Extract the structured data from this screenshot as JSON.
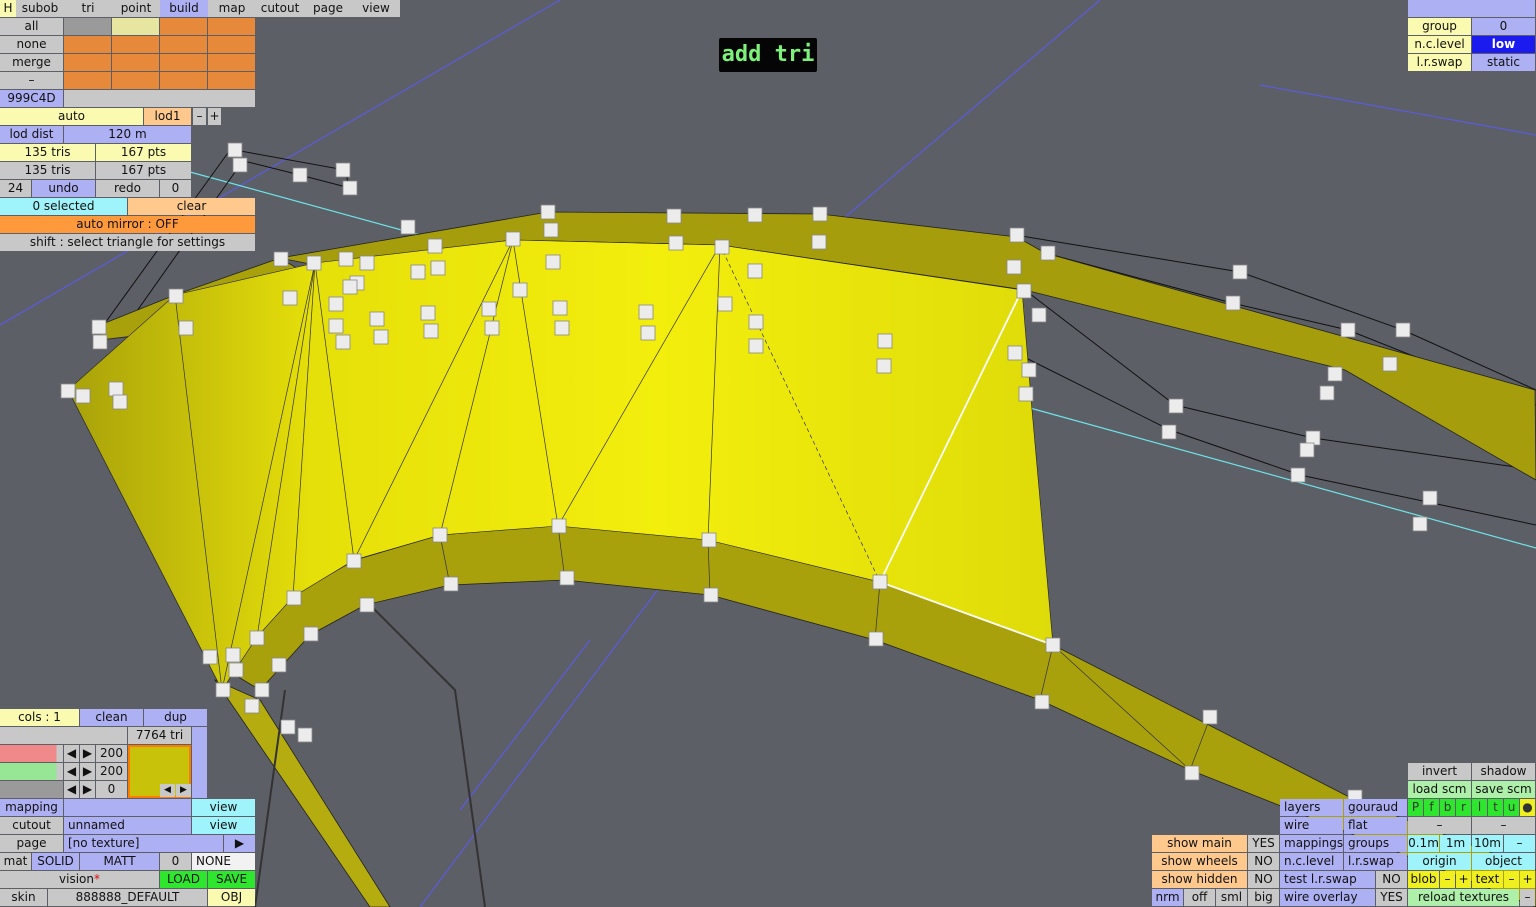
{
  "notice": "add tri",
  "top_tabs": [
    "H",
    "subob",
    "tri",
    "point",
    "build",
    "map",
    "cutout",
    "page",
    "view"
  ],
  "select": {
    "all": "all",
    "none": "none",
    "merge": "merge",
    "minus": "–"
  },
  "hex_id": "999C4D",
  "lod": {
    "auto": "auto",
    "lod1": "lod1",
    "minus": "–",
    "plus": "+",
    "dist_label": "lod dist",
    "dist_value": "120 m"
  },
  "counts": {
    "tris_a": "135 tris",
    "pts_a": "167 pts",
    "tris_b": "135 tris",
    "pts_b": "167 pts"
  },
  "history": {
    "left": "24",
    "undo": "undo",
    "redo": "redo",
    "right": "0"
  },
  "selection": {
    "selected": "0 selected",
    "clear": "clear",
    "mirror": "auto mirror : OFF",
    "hint": "shift : select triangle for settings"
  },
  "material": {
    "cols": "cols : 1",
    "clean": "clean",
    "dup": "dup",
    "tri_count": "7764 tri",
    "slider1": "200",
    "slider2": "200",
    "slider3": "0",
    "swatch_color": "#c9c20b",
    "mapping": "mapping",
    "view": "view",
    "cutout": "cutout",
    "cutout_val": "unnamed",
    "page": "page",
    "page_val": "[no texture]",
    "arrow": "▶",
    "mat": "mat",
    "solid": "SOLID",
    "matt": "MATT",
    "zero": "0",
    "none": "NONE",
    "vision": "vision",
    "star": "*",
    "load": "LOAD",
    "save": "SAVE",
    "skin": "skin",
    "skin_val": "888888_DEFAULT",
    "obj": "OBJ"
  },
  "top_right": {
    "group": "group",
    "group_val": "0",
    "nclevel": "n.c.level",
    "nclevel_val": "low",
    "lrswap": "l.r.swap",
    "lrswap_val": "static"
  },
  "bottom_mid": {
    "show_main": "show main",
    "yes1": "YES",
    "show_wheels": "show wheels",
    "no1": "NO",
    "show_hidden": "show hidden",
    "no2": "NO",
    "nrm": "nrm",
    "off": "off",
    "sml": "sml",
    "big": "big"
  },
  "bottom_right": {
    "layers": "layers",
    "gouraud": "gouraud",
    "wire": "wire",
    "flat": "flat",
    "mappings": "mappings",
    "groups": "groups",
    "nclevel": "n.c.level",
    "lrswap": "l.r.swap",
    "test_lrswap": "test l.r.swap",
    "no": "NO",
    "wire_overlay": "wire overlay",
    "yes": "YES",
    "invert": "invert",
    "shadow": "shadow",
    "load_scm": "load scm",
    "save_scm": "save scm",
    "flags": [
      "P",
      "f",
      "b",
      "r",
      "l",
      "t",
      "u",
      "●"
    ],
    "dash1": "–",
    "dash2": "–",
    "s01": "0.1m",
    "s1": "1m",
    "s10": "10m",
    "sdash": "–",
    "origin": "origin",
    "object": "object",
    "blob": "blob",
    "bminus": "–",
    "bplus": "+",
    "text": "text",
    "tminus": "–",
    "tplus": "+",
    "reload": "reload textures",
    "rdash": "–"
  }
}
